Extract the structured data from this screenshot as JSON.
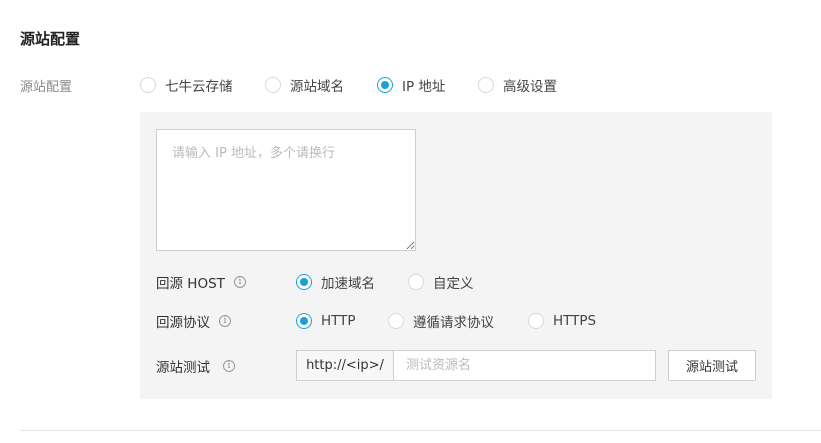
{
  "section_title": "源站配置",
  "origin": {
    "label": "源站配置",
    "options": [
      {
        "label": "七牛云存储",
        "checked": false
      },
      {
        "label": "源站域名",
        "checked": false
      },
      {
        "label": "IP 地址",
        "checked": true
      },
      {
        "label": "高级设置",
        "checked": false
      }
    ]
  },
  "ip_input": {
    "placeholder": "请输入 IP 地址，多个请换行",
    "value": ""
  },
  "host": {
    "label": "回源 HOST",
    "info_icon": "info-icon",
    "options": [
      {
        "label": "加速域名",
        "checked": true
      },
      {
        "label": "自定义",
        "checked": false
      }
    ]
  },
  "protocol": {
    "label": "回源协议",
    "info_icon": "info-icon",
    "options": [
      {
        "label": "HTTP",
        "checked": true
      },
      {
        "label": "遵循请求协议",
        "checked": false
      },
      {
        "label": "HTTPS",
        "checked": false
      }
    ]
  },
  "test": {
    "label": "源站测试",
    "info_icon": "info-icon",
    "prefix": "http://<ip>/",
    "input_placeholder": "测试资源名",
    "input_value": "",
    "button_label": "源站测试"
  },
  "colors": {
    "accent": "#1aa0d8",
    "panel_bg": "#f4f4f4"
  }
}
